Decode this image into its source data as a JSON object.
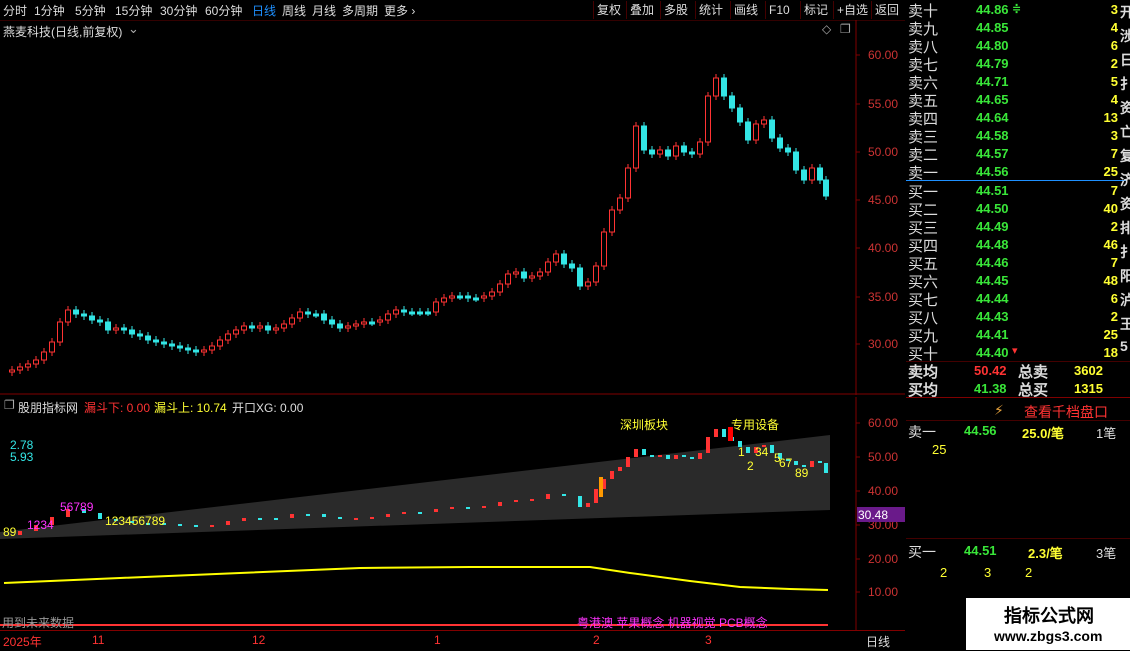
{
  "toolbar": {
    "periods": [
      "分时",
      "1分钟",
      "5分钟",
      "15分钟",
      "30分钟",
      "60分钟",
      "日线",
      "周线",
      "月线",
      "多周期",
      "更多"
    ],
    "active_period": "日线",
    "buttons": [
      "复权",
      "叠加",
      "多股",
      "统计",
      "画线",
      "F10",
      "标记",
      "+自选",
      "返回"
    ]
  },
  "main_chart": {
    "stock_title": "燕麦科技(日线,前复权)",
    "y_ticks": [
      "60.00",
      "55.00",
      "50.00",
      "45.00",
      "40.00",
      "35.00",
      "30.00"
    ]
  },
  "indicator": {
    "name": "股朋指标网",
    "label1": "漏斗下: 0.00",
    "label2": "漏斗上: 10.74",
    "label3": "开口XG: 0.00",
    "val_a": "2.78",
    "val_b": "5.93",
    "tag1": "深圳板块",
    "tag2": "专用设备",
    "price_box": "30.48",
    "y_ticks": [
      "60.00",
      "50.00",
      "40.00",
      "30.00",
      "20.00",
      "10.00"
    ],
    "footer_note": "用到未来数据",
    "concepts": "粤港澳 苹果概念 机器视觉 PCB概念",
    "seq_1": "89",
    "seq_2": "1234",
    "seq_3": "56789",
    "seq_4": "123456789",
    "seq_5": "1",
    "seq_6": "2",
    "seq_7": "34",
    "seq_8": "5",
    "seq_9": "67",
    "seq_10": "89"
  },
  "time_axis": {
    "labels": [
      "2025年",
      "11",
      "12",
      "1",
      "2",
      "3"
    ],
    "period_label": "日线"
  },
  "order_book": {
    "asks": [
      {
        "label": "卖十",
        "price": "44.86",
        "vol": "3"
      },
      {
        "label": "卖九",
        "price": "44.85",
        "vol": "4"
      },
      {
        "label": "卖八",
        "price": "44.80",
        "vol": "6"
      },
      {
        "label": "卖七",
        "price": "44.79",
        "vol": "2"
      },
      {
        "label": "卖六",
        "price": "44.71",
        "vol": "5"
      },
      {
        "label": "卖五",
        "price": "44.65",
        "vol": "4"
      },
      {
        "label": "卖四",
        "price": "44.64",
        "vol": "13"
      },
      {
        "label": "卖三",
        "price": "44.58",
        "vol": "3"
      },
      {
        "label": "卖二",
        "price": "44.57",
        "vol": "7"
      },
      {
        "label": "卖一",
        "price": "44.56",
        "vol": "25"
      }
    ],
    "bids": [
      {
        "label": "买一",
        "price": "44.51",
        "vol": "7"
      },
      {
        "label": "买二",
        "price": "44.50",
        "vol": "40"
      },
      {
        "label": "买三",
        "price": "44.49",
        "vol": "2"
      },
      {
        "label": "买四",
        "price": "44.48",
        "vol": "46"
      },
      {
        "label": "买五",
        "price": "44.46",
        "vol": "7"
      },
      {
        "label": "买六",
        "price": "44.45",
        "vol": "48"
      },
      {
        "label": "买七",
        "price": "44.44",
        "vol": "6"
      },
      {
        "label": "买八",
        "price": "44.43",
        "vol": "2"
      },
      {
        "label": "买九",
        "price": "44.41",
        "vol": "25"
      },
      {
        "label": "买十",
        "price": "44.40",
        "vol": "18"
      }
    ],
    "avg_sell_label": "卖均",
    "avg_sell": "50.42",
    "total_sell_label": "总卖",
    "total_sell": "3602",
    "avg_buy_label": "买均",
    "avg_buy": "41.38",
    "total_buy_label": "总买",
    "total_buy": "1315",
    "side_text": [
      "开",
      "涉",
      "日",
      "扌",
      "资",
      "亡",
      "复",
      "济",
      "资",
      "排",
      "扌",
      "阳",
      "泸",
      "王",
      "5"
    ]
  },
  "trade_panel": {
    "link": "查看千档盘口",
    "sell_label": "卖一",
    "sell_price": "44.56",
    "sell_per": "25.0/笔",
    "sell_count": "1笔",
    "sell_queue": [
      "25"
    ],
    "buy_label": "买一",
    "buy_price": "44.51",
    "buy_per": "2.3/笔",
    "buy_count": "3笔",
    "buy_queue": [
      "2",
      "3",
      "2"
    ]
  },
  "watermark": {
    "title": "指标公式网",
    "url": "www.zbgs3.com"
  },
  "colors": {
    "up": "#ff3333",
    "down": "#33e6e6",
    "yellow": "#ffff33",
    "magenta": "#ff33ff",
    "accent": "#1e90ff"
  }
}
